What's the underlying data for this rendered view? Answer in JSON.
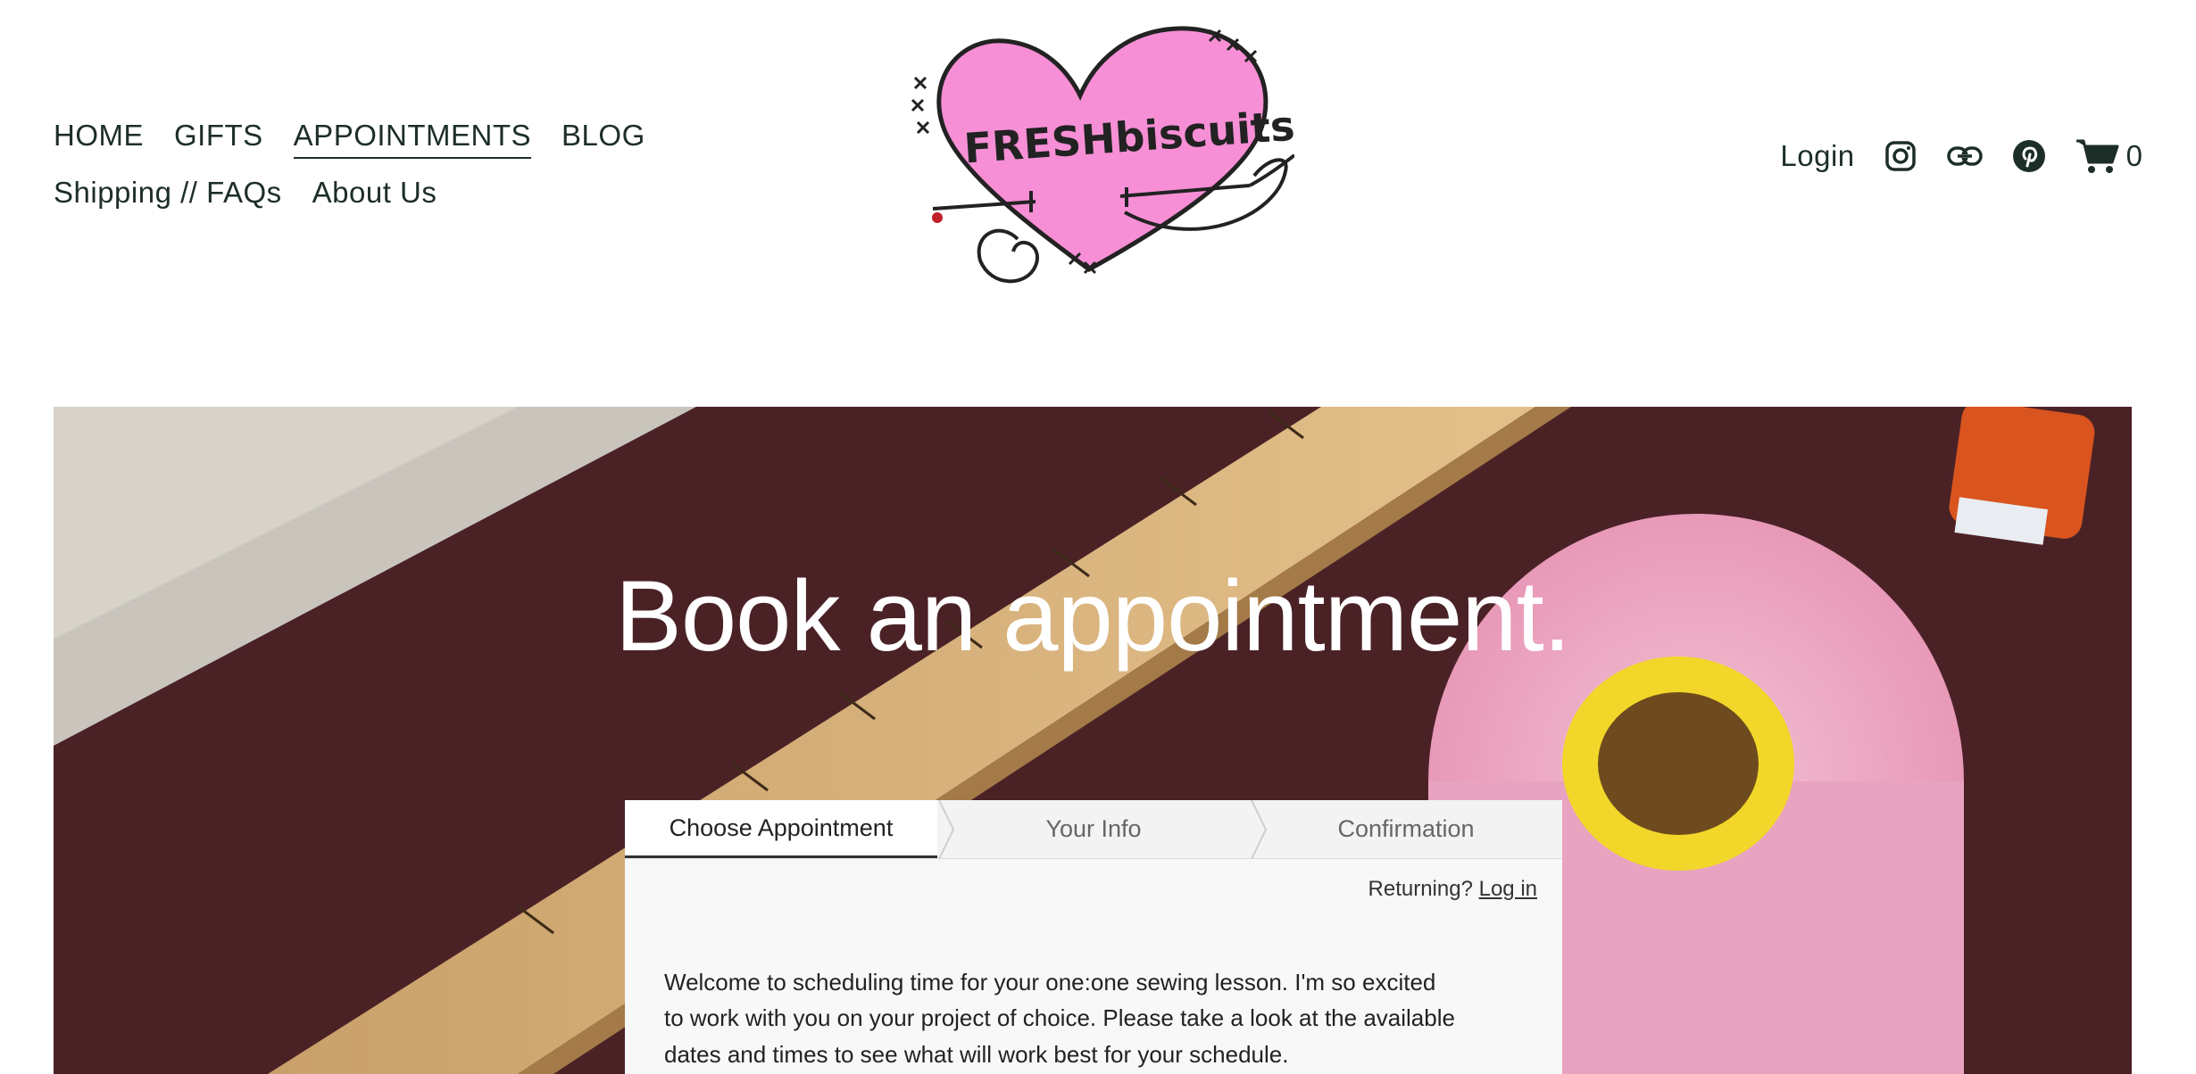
{
  "nav": {
    "row1": [
      "HOME",
      "GIFTS",
      "APPOINTMENTS",
      "BLOG"
    ],
    "row2": [
      "Shipping // FAQs",
      "About Us"
    ],
    "active": "APPOINTMENTS"
  },
  "logo": {
    "text": "FRESHbiscuits",
    "color": "#f78fd6"
  },
  "header": {
    "login": "Login",
    "icons": [
      "instagram-icon",
      "link-icon",
      "pinterest-icon",
      "cart-icon"
    ],
    "cart_count": "0"
  },
  "hero": {
    "title": "Book an appointment."
  },
  "scheduler": {
    "steps": [
      "Choose Appointment",
      "Your Info",
      "Confirmation"
    ],
    "active_step": "Choose Appointment",
    "returning_label": "Returning?",
    "login_link": "Log in",
    "welcome": "Welcome to scheduling time for your one:one sewing lesson. I'm so excited to work with you on your project of choice. Please take a look at the available dates and times to see what will work best for your schedule."
  },
  "colors": {
    "text": "#1d2e28",
    "hero_bg": "#4a2226",
    "logo_pink": "#f78fd6"
  }
}
